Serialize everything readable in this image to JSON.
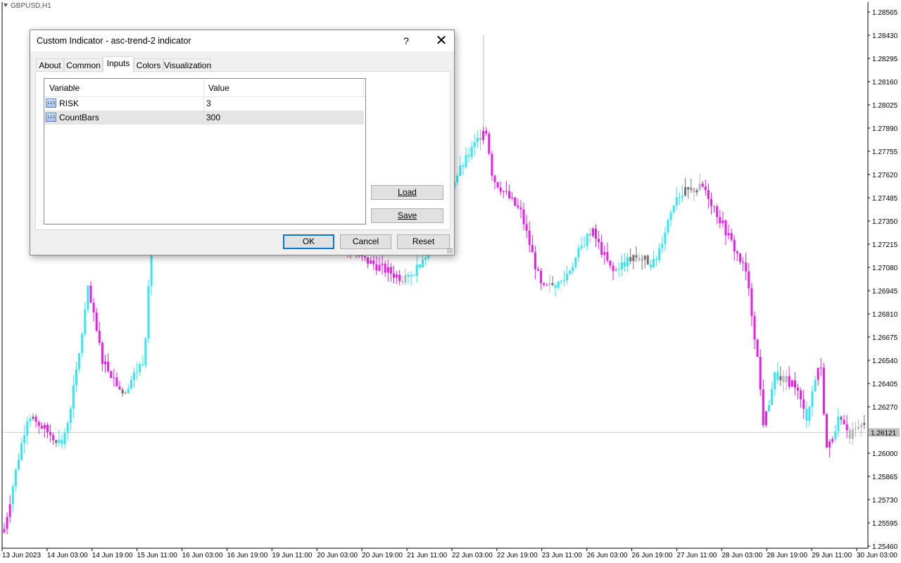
{
  "chart": {
    "symbol": "GBPUSD,H1",
    "price_labels": [
      "1.28565",
      "1.28430",
      "1.28295",
      "1.28160",
      "1.28025",
      "1.27890",
      "1.27755",
      "1.27620",
      "1.27485",
      "1.27350",
      "1.27215",
      "1.27080",
      "1.26945",
      "1.26810",
      "1.26675",
      "1.26540",
      "1.26405",
      "1.26270",
      "1.26121",
      "1.26000",
      "1.25865",
      "1.25730",
      "1.25595",
      "1.25460"
    ],
    "current_price": "1.26121",
    "time_labels": [
      "13 Jun 2023",
      "14 Jun 03:00",
      "14 Jun 19:00",
      "15 Jun 11:00",
      "16 Jun 03:00",
      "16 Jun 19:00",
      "19 Jun 11:00",
      "20 Jun 03:00",
      "20 Jun 19:00",
      "21 Jun 11:00",
      "22 Jun 03:00",
      "22 Jun 19:00",
      "23 Jun 11:00",
      "26 Jun 03:00",
      "26 Jun 19:00",
      "27 Jun 11:00",
      "28 Jun 03:00",
      "28 Jun 19:00",
      "29 Jun 11:00",
      "30 Jun 03:00"
    ],
    "colors": {
      "up": "#33e6f2",
      "down": "#e61de6",
      "neutral_dark": "#6e6e6e",
      "neutral_light": "#b4b4b4",
      "grid_line": "#c8c8c8",
      "axis": "#000000"
    }
  },
  "dialog": {
    "title": "Custom Indicator - asc-trend-2 indicator",
    "help": "?",
    "close": "✕",
    "tabs": [
      "About",
      "Common",
      "Inputs",
      "Colors",
      "Visualization"
    ],
    "active_tab": "Inputs",
    "grid": {
      "headers": [
        "Variable",
        "Value"
      ],
      "rows": [
        {
          "icon": "123",
          "name": "RISK",
          "value": "3"
        },
        {
          "icon": "123",
          "name": "CountBars",
          "value": "300"
        }
      ]
    },
    "side_buttons": {
      "load": "Load",
      "save": "Save"
    },
    "footer_buttons": {
      "ok": "OK",
      "cancel": "Cancel",
      "reset": "Reset"
    }
  }
}
